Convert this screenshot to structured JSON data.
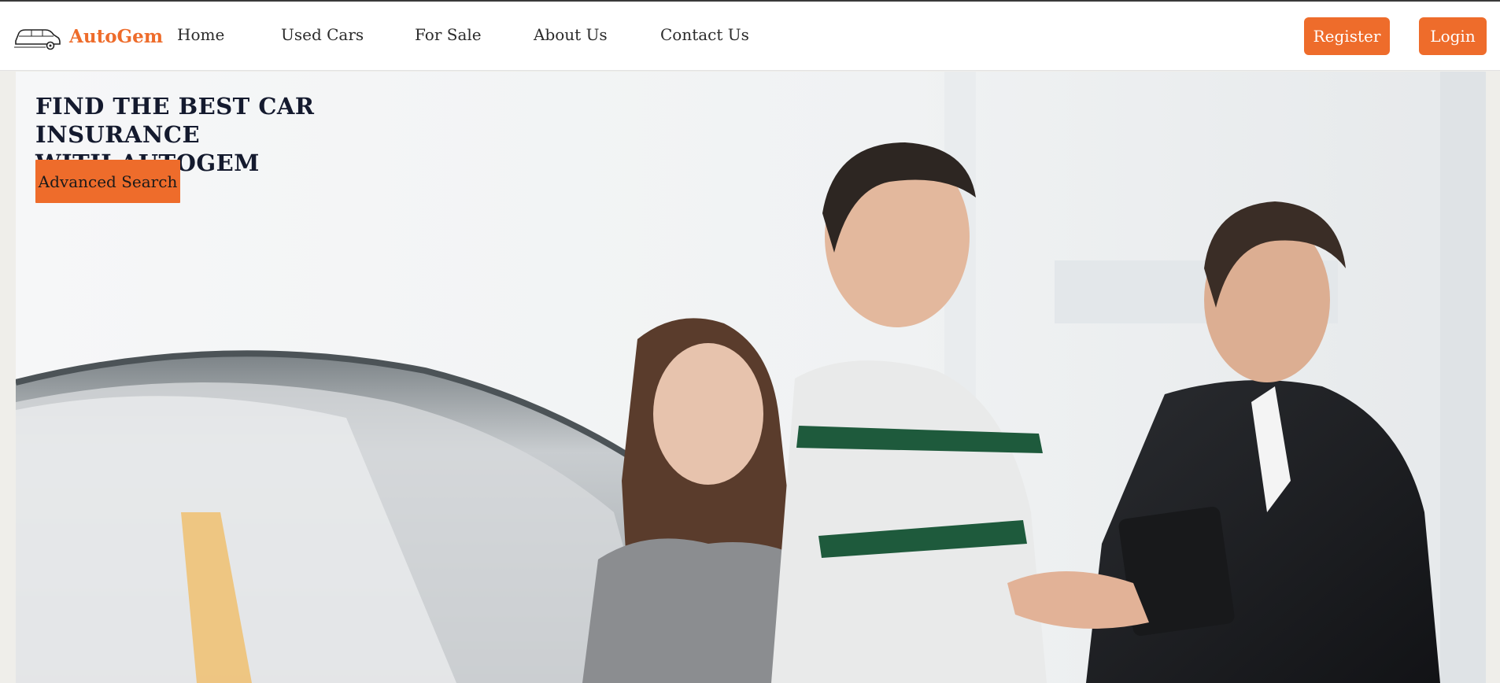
{
  "brand": {
    "name": "AutoGem",
    "logo_icon": "car-outline-icon",
    "accent_color": "#ee6c2b"
  },
  "nav": {
    "items": [
      {
        "label": "Home"
      },
      {
        "label": "Used Cars"
      },
      {
        "label": "For Sale"
      },
      {
        "label": "About Us"
      },
      {
        "label": "Contact Us"
      }
    ]
  },
  "auth": {
    "register_label": "Register",
    "login_label": "Login"
  },
  "hero": {
    "title_line1": "FIND THE BEST CAR INSURANCE",
    "title_line2": "WITH AUTOGEM",
    "cta_label": "Advanced Search"
  }
}
